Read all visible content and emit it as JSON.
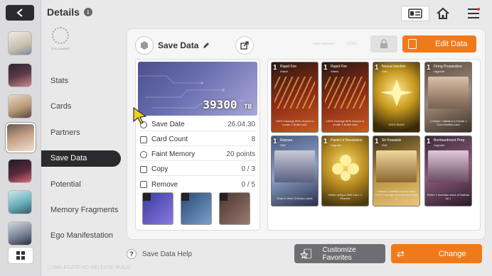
{
  "header": {
    "title": "Details",
    "info_icon": "i"
  },
  "emblem_caption": "GOD-NAMING",
  "nav": {
    "items": [
      "Stats",
      "Cards",
      "Partners",
      "Save Data",
      "Potential",
      "Memory Fragments",
      "Ego Manifestation"
    ],
    "selected": "Save Data"
  },
  "save": {
    "title": "Save Data",
    "tiny_label": "FAINT MEMORY",
    "edit_label": "Edit Data",
    "tb_value": "39300",
    "tb_unit": "TB",
    "rows": [
      {
        "label": "Save Date",
        "value": "26.04.30"
      },
      {
        "label": "Card Count",
        "value": "8"
      },
      {
        "label": "Faint Memory",
        "value": "20 points"
      },
      {
        "label": "Copy",
        "value": "0 / 3"
      },
      {
        "label": "Remove",
        "value": "0 / 5"
      }
    ]
  },
  "cards": [
    {
      "cost": "1",
      "name": "Rapid Fire",
      "type": "Attack",
      "desc": "100% Damage 80% chance to create 1 Bullet card"
    },
    {
      "cost": "1",
      "name": "Rapid Fire",
      "type": "Attack",
      "desc": "100% Damage 80% chance to create 1 Bullet card"
    },
    {
      "cost": "1",
      "name": "Neural Interlink",
      "type": "Skill",
      "desc": "100% Shield"
    },
    {
      "cost": "1",
      "name": "Firing Preparation",
      "type": "Upgrade",
      "desc": "[ Unique / Initiation ] Create 1 Giant Ballista card"
    },
    {
      "cost": "1",
      "name": "Repose",
      "type": "Skill",
      "desc": "Draw 2 other Chimera cards"
    },
    {
      "cost": "1",
      "name": "Pastel of Resolution",
      "type": "Upgrade",
      "desc": "When using a Skill Card, 1 Resolve"
    },
    {
      "cost": "1",
      "name": "Sir Kowalski",
      "type": "Skill",
      "desc": "Choose 1 Ballista card in hand. 100% Damage and activate Draw 1"
    },
    {
      "cost": "1",
      "name": "Bombardment Prep",
      "type": "Upgrade",
      "desc": "Retire 1 Increase stack of Ballista by 1"
    }
  ],
  "bottom": {
    "help_label": "Save Data Help",
    "favorites_label": "Customize Favorites",
    "change_label": "Change"
  },
  "watermark": "ⓒSMILEGATE-NO-RELEASE-BUILD",
  "colors": {
    "accent": "#f07a1a",
    "dark": "#2b2b2f"
  }
}
